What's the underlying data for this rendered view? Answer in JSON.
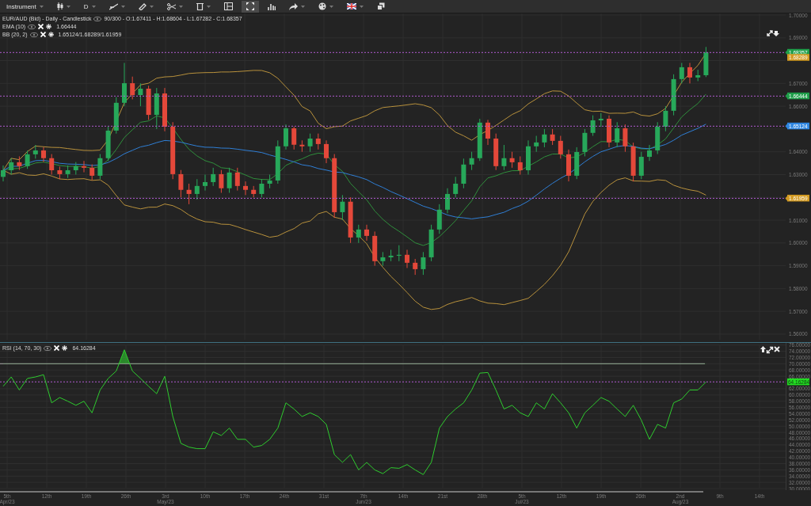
{
  "toolbar": [
    {
      "kind": "text",
      "label": "Instrument",
      "dropdown": true,
      "selected": false
    },
    {
      "kind": "icon",
      "dropdown": true,
      "selected": false
    },
    {
      "kind": "text",
      "label": "D",
      "dropdown": true,
      "selected": false
    },
    {
      "kind": "icon",
      "dropdown": true,
      "selected": false
    },
    {
      "kind": "icon",
      "dropdown": true,
      "selected": false
    },
    {
      "kind": "icon",
      "dropdown": true,
      "selected": false
    },
    {
      "kind": "icon",
      "dropdown": true,
      "selected": false
    },
    {
      "kind": "icon",
      "dropdown": false,
      "selected": false
    },
    {
      "kind": "icon",
      "dropdown": false,
      "selected": true
    },
    {
      "kind": "icon",
      "dropdown": false,
      "selected": false
    },
    {
      "kind": "icon",
      "dropdown": true,
      "selected": false
    },
    {
      "kind": "icon",
      "dropdown": true,
      "selected": false
    },
    {
      "kind": "icon",
      "dropdown": true,
      "selected": false
    },
    {
      "kind": "icon",
      "dropdown": false,
      "selected": false
    }
  ],
  "price_chart": {
    "legend": {
      "title": "EUR/AUD (Bid) - Daily - Candlestick",
      "info": "90/300 - O:1.67411 - H:1.68604 - L:1.67282 - C:1.68357"
    },
    "indicators": [
      {
        "kind": "ema",
        "name": "EMA (10)",
        "value": "1.66444"
      },
      {
        "kind": "bb",
        "name": "BB (20, 2)",
        "value": "1.65124/1.68289/1.61959"
      }
    ],
    "axis_labels": [
      "1.70000",
      "1.69000",
      "1.67000",
      "1.66000",
      "1.64000",
      "1.63000",
      "1.61000",
      "1.60000",
      "1.59000",
      "1.58000",
      "1.57000",
      "1.56000"
    ],
    "price_labels": [
      {
        "text": "1.68357",
        "color": "#1f9e4a",
        "line": true
      },
      {
        "text": "1.68289",
        "color": "#d29a22",
        "line": false
      },
      {
        "text": "1.66444",
        "color": "#1f9e4a",
        "line": true
      },
      {
        "text": "1.65124",
        "color": "#2f86e0",
        "line": true
      },
      {
        "text": "1.61959",
        "color": "#d29a22",
        "line": true
      }
    ]
  },
  "rsi_chart": {
    "legend_value": "64.16284",
    "axis_value": "64.16284",
    "chart_data": {
      "type": "line",
      "grid": true,
      "ylim": [
        29.5,
        76.7
      ],
      "yticks": [
        {
          "value": 30,
          "label": "30.00000"
        },
        {
          "value": 32,
          "label": "32.00000"
        },
        {
          "value": 34,
          "label": "34.00000"
        },
        {
          "value": 36,
          "label": "36.00000"
        },
        {
          "value": 38,
          "label": "38.00000"
        },
        {
          "value": 40,
          "label": "40.00000"
        },
        {
          "value": 42,
          "label": "42.00000"
        },
        {
          "value": 44,
          "label": "44.00000"
        },
        {
          "value": 46,
          "label": "46.00000"
        },
        {
          "value": 48,
          "label": "48.00000"
        },
        {
          "value": 50,
          "label": "50.00000"
        },
        {
          "value": 52,
          "label": "52.00000"
        },
        {
          "value": 54,
          "label": "54.00000"
        },
        {
          "value": 56,
          "label": "56.00000"
        },
        {
          "value": 58,
          "label": "58.00000"
        },
        {
          "value": 60,
          "label": "60.00000"
        },
        {
          "value": 62,
          "label": "62.00000"
        },
        {
          "value": 66,
          "label": "66.00000"
        },
        {
          "value": 68,
          "label": "68.00000"
        },
        {
          "value": 70,
          "label": "70.00000"
        },
        {
          "value": 72,
          "label": "72.00000"
        },
        {
          "value": 74,
          "label": "74.00000"
        },
        {
          "value": 76,
          "label": "76.00000"
        }
      ],
      "ref_lines": [
        {
          "axis": "y",
          "value": 70
        },
        {
          "axis": "y",
          "value": 64.2
        }
      ],
      "series": [
        {
          "name": "RSI (14, 70, 30)",
          "color": "#2ecc2e",
          "values": [
            62.8,
            65.8,
            61.6,
            65.3,
            65.8,
            66.5,
            57.5,
            59.2,
            58.0,
            56.7,
            58.0,
            54.3,
            61.6,
            65.3,
            67.7,
            74.5,
            67.7,
            65.3,
            62.8,
            60.4,
            66.0,
            53.1,
            44.5,
            43.3,
            42.8,
            42.8,
            48.2,
            47.0,
            49.4,
            45.8,
            45.8,
            43.3,
            43.8,
            45.8,
            49.4,
            57.5,
            55.5,
            53.1,
            54.3,
            53.1,
            50.6,
            40.9,
            38.4,
            40.9,
            36.0,
            38.4,
            36.0,
            34.8,
            36.7,
            36.5,
            37.7,
            36.0,
            34.5,
            38.4,
            49.4,
            53.1,
            55.5,
            57.5,
            61.6,
            67.0,
            67.2,
            61.6,
            55.5,
            56.7,
            54.3,
            53.1,
            57.5,
            55.5,
            60.4,
            57.5,
            54.3,
            49.4,
            54.3,
            56.7,
            59.2,
            58.0,
            55.5,
            53.1,
            56.7,
            51.9,
            45.8,
            50.6,
            49.4,
            57.5,
            58.7,
            61.6,
            61.6,
            64.2
          ]
        }
      ]
    }
  },
  "date_axis": [
    "5th\nApr/23",
    "12th",
    "19th",
    "26th",
    "3rd\nMay/23",
    "10th",
    "17th",
    "24th",
    "31st",
    "7th\nJun/23",
    "14th",
    "21st",
    "28th",
    "5th\nJul/23",
    "12th",
    "19th",
    "26th",
    "2nd\nAug/23",
    "9th",
    "14th"
  ]
}
